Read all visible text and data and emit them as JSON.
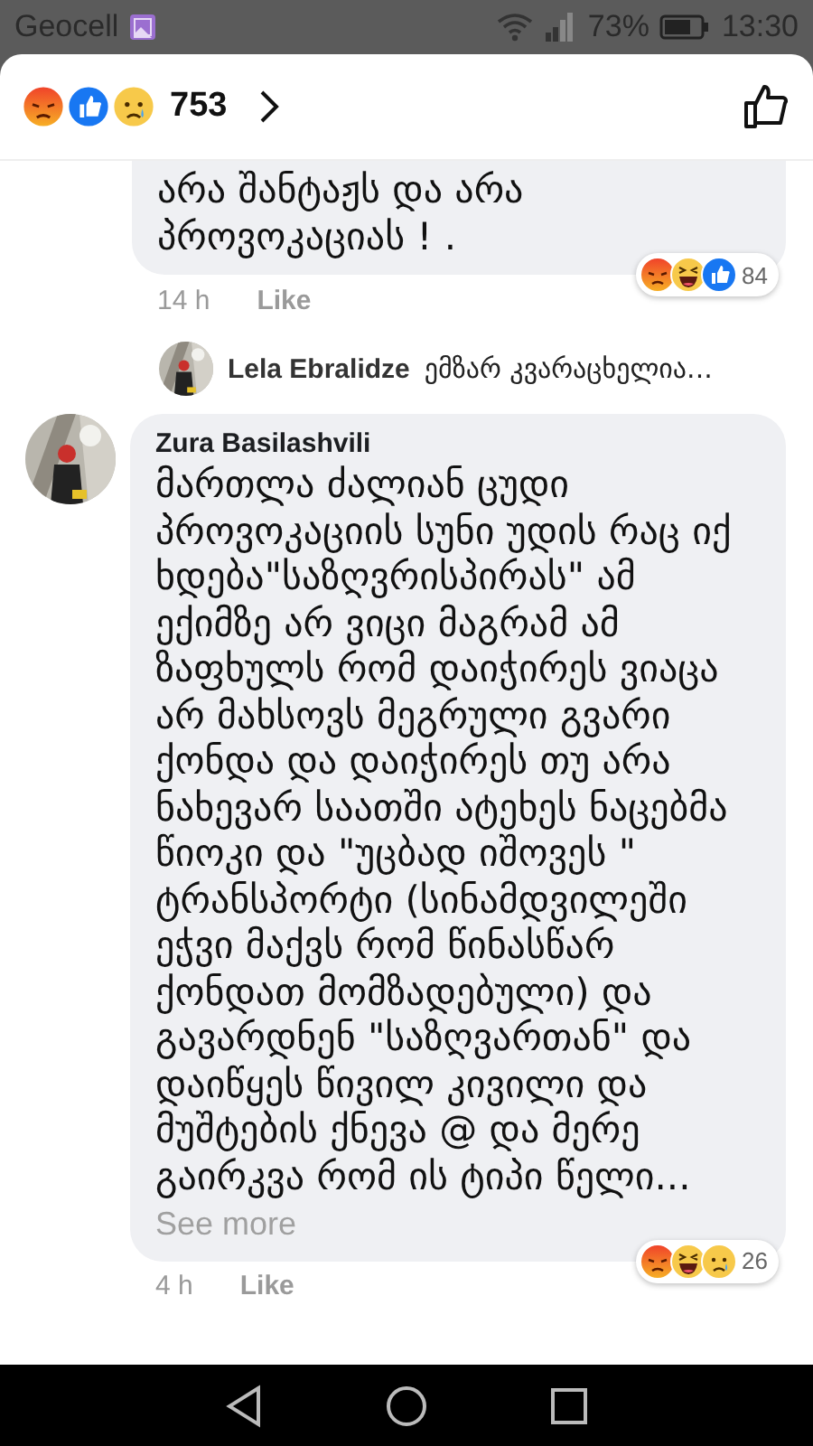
{
  "status_bar": {
    "carrier": "Geocell",
    "battery": "73%",
    "time": "13:30"
  },
  "header": {
    "reactions": [
      {
        "kind": "angry"
      },
      {
        "kind": "like"
      },
      {
        "kind": "sad"
      }
    ],
    "count": "753"
  },
  "comments": [
    {
      "kind": "comment",
      "partial": true,
      "text": "არა შანტაჟს და არა პროვოკაციას ! .",
      "time": "14 h",
      "like": "Like",
      "reactions": [
        {
          "kind": "angry"
        },
        {
          "kind": "haha"
        },
        {
          "kind": "like"
        }
      ],
      "reaction_count": "84"
    },
    {
      "kind": "reply",
      "author": "Lela Ebralidze",
      "text": "ემზარ კვარაცხელია..."
    },
    {
      "kind": "comment",
      "partial": false,
      "author": "Zura Basilashvili",
      "text": "მართლა ძალიან ცუდი პროვოკაციის სუნი უდის რაც იქ ხდება\"საზღვრისპირას\" ამ ექიმზე არ ვიცი მაგრამ ამ ზაფხულს რომ დაიჭირეს ვიაცა არ მახსოვს მეგრული გვარი ქონდა და დაიჭირეს თუ არა ნახევარ საათში ატეხეს ნაცებმა წიოკი და \"უცბად იშოვეს \" ტრანსპორტი (სინამდვილეში ეჭვი მაქვს რომ წინასწარ ქონდათ მომზადებული) და გავარდნენ \"საზღვართან\" და დაიწყეს წივილ კივილი და მუშტების ქნევა @ და მერე გაირკვა რომ ის ტიპი წელი...",
      "see_more": "See more",
      "time": "4 h",
      "like": "Like",
      "reactions": [
        {
          "kind": "angry"
        },
        {
          "kind": "haha"
        },
        {
          "kind": "sad"
        }
      ],
      "reaction_count": "26"
    }
  ]
}
